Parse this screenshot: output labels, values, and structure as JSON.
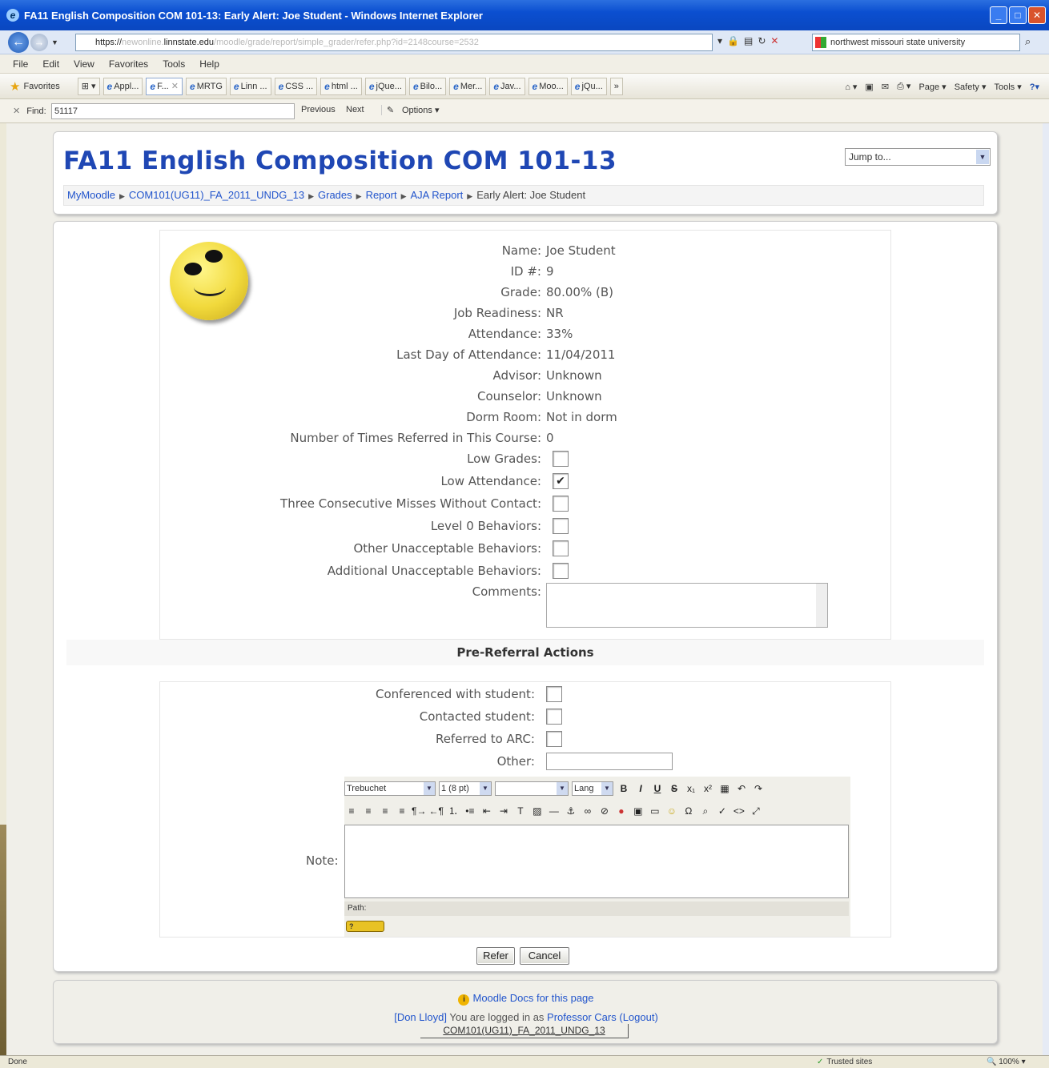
{
  "window": {
    "title": "FA11 English Composition COM 101-13: Early Alert: Joe Student - Windows Internet Explorer",
    "btn_min": "_",
    "btn_max": "□",
    "btn_close": "✕"
  },
  "address": {
    "url_prefix": "https://",
    "url_host_faint": "newonline.",
    "url_host": "linnstate.edu",
    "url_path": "/moodle/grade/report/simple_grader/refer.php?id=2148course=2532",
    "search_text": "northwest missouri state university"
  },
  "menu": [
    "File",
    "Edit",
    "View",
    "Favorites",
    "Tools",
    "Help"
  ],
  "favorites": {
    "label": "Favorites",
    "tabs": [
      "Appl...",
      "F...",
      "MRTG",
      "Linn ...",
      "CSS ...",
      "html ...",
      "jQue...",
      "Bilo...",
      "Mer...",
      "Jav...",
      "Moo...",
      "jQu..."
    ],
    "more": "»",
    "commands": [
      "Page ▾",
      "Safety ▾",
      "Tools ▾"
    ]
  },
  "findbar": {
    "label": "Find:",
    "value": "51117",
    "previous": "Previous",
    "next": "Next",
    "options": "Options ▾"
  },
  "header": {
    "course_title": "FA11 English Composition COM 101-13",
    "jump_placeholder": "Jump to...",
    "breadcrumb": [
      "MyMoodle",
      "COM101(UG11)_FA_2011_UNDG_13",
      "Grades",
      "Report",
      "AJA Report"
    ],
    "breadcrumb_current": "Early Alert: Joe Student"
  },
  "student": {
    "fields": [
      {
        "label": "Name:",
        "value": "Joe Student"
      },
      {
        "label": "ID #:",
        "value": "9"
      },
      {
        "label": "Grade:",
        "value": "80.00% (B)"
      },
      {
        "label": "Job Readiness:",
        "value": "NR"
      },
      {
        "label": "Attendance:",
        "value": "33%"
      },
      {
        "label": "Last Day of Attendance:",
        "value": "11/04/2011"
      },
      {
        "label": "Advisor:",
        "value": "Unknown"
      },
      {
        "label": "Counselor:",
        "value": "Unknown"
      },
      {
        "label": "Dorm Room:",
        "value": "Not in dorm"
      },
      {
        "label": "Number of Times Referred in This Course:",
        "value": "0"
      }
    ],
    "checks": [
      {
        "label": "Low Grades:",
        "checked": false
      },
      {
        "label": "Low Attendance:",
        "checked": true
      },
      {
        "label": "Three Consecutive Misses Without Contact:",
        "checked": false
      },
      {
        "label": "Level 0 Behaviors:",
        "checked": false
      },
      {
        "label": "Other Unacceptable Behaviors:",
        "checked": false
      },
      {
        "label": "Additional Unacceptable Behaviors:",
        "checked": false
      }
    ],
    "comments_label": "Comments:"
  },
  "pre_referral": {
    "title": "Pre-Referral Actions",
    "checks": [
      {
        "label": "Conferenced with student:",
        "checked": false
      },
      {
        "label": "Contacted student:",
        "checked": false
      },
      {
        "label": "Referred to ARC:",
        "checked": false
      }
    ],
    "other_label": "Other:",
    "note_label": "Note:",
    "editor": {
      "font": "Trebuchet",
      "size": "1 (8 pt)",
      "lang": "Lang",
      "path_label": "Path:"
    }
  },
  "actions": {
    "refer": "Refer",
    "cancel": "Cancel"
  },
  "footer": {
    "docs_link": "Moodle Docs for this page",
    "user_link": "[Don Lloyd]",
    "logged_text": "You are logged in as",
    "role_link": "Professor Cars",
    "logout": "(Logout)",
    "course_link": "COM101(UG11)_FA_2011_UNDG_13"
  },
  "status": {
    "left": "Done",
    "zone": "Trusted sites",
    "zoom": "100%"
  }
}
